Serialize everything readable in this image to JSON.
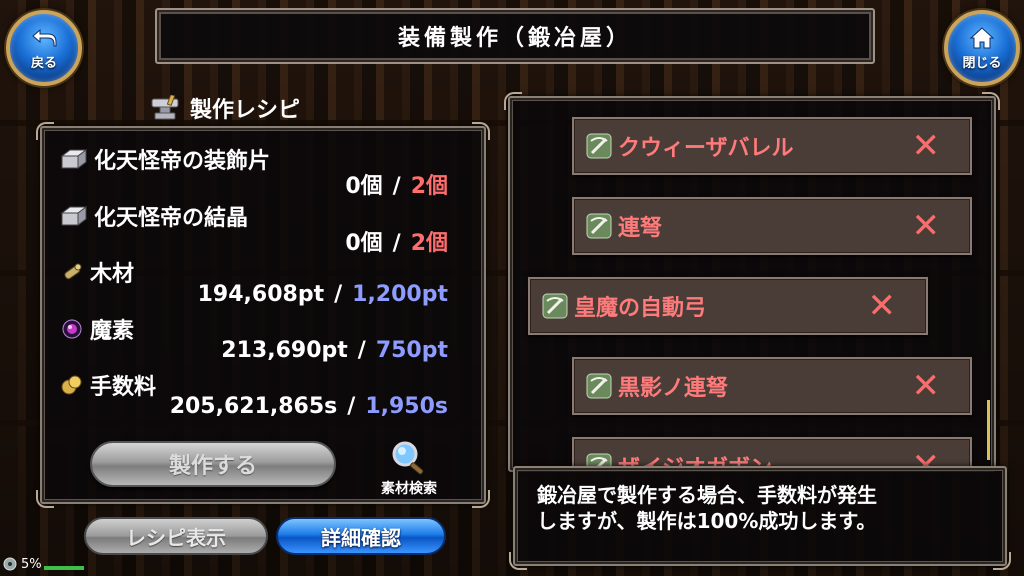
{
  "nav": {
    "back_label": "戻る",
    "close_label": "閉じる"
  },
  "title": "装備製作（鍛冶屋）",
  "recipe_panel": {
    "header": "製作レシピ",
    "materials": [
      {
        "icon": "ingot-icon",
        "name": "化天怪帝の装飾片",
        "have": "0個",
        "need": "2個",
        "need_color": "#ff6d6d"
      },
      {
        "icon": "ingot-icon",
        "name": "化天怪帝の結晶",
        "have": "0個",
        "need": "2個",
        "need_color": "#ff6d6d"
      },
      {
        "icon": "wood-icon",
        "name": "木材",
        "have": "194,608pt",
        "need": "1,200pt",
        "need_color": "#8e9cff"
      },
      {
        "icon": "magic-orb-icon",
        "name": "魔素",
        "have": "213,690pt",
        "need": "750pt",
        "need_color": "#8e9cff"
      },
      {
        "icon": "coin-icon",
        "name": "手数料",
        "have": "205,621,865s",
        "need": "1,950s",
        "need_color": "#8e9cff"
      }
    ],
    "slash": "/",
    "craft_button": "製作する",
    "search_label": "素材検索"
  },
  "bottom_buttons": {
    "recipe_view": "レシピ表示",
    "detail_confirm": "詳細確認"
  },
  "recipe_list": {
    "items": [
      {
        "name": "クウィーザバレル",
        "mark": "✕",
        "selected": false
      },
      {
        "name": "連弩",
        "mark": "✕",
        "selected": false
      },
      {
        "name": "皇魔の自動弓",
        "mark": "✕",
        "selected": true
      },
      {
        "name": "黒影ノ連弩",
        "mark": "✕",
        "selected": false
      },
      {
        "name": "ザイジオガボン",
        "mark": "✕",
        "selected": false
      }
    ]
  },
  "info": "鍛冶屋で製作する場合、手数料が発生\nしますが、製作は100%成功します。",
  "status": {
    "percent": "5%"
  },
  "colors": {
    "accent_red": "#ff6d6d",
    "accent_blue": "#8e9cff",
    "nav_blue": "#1a6fd6",
    "gold": "#c9a45a"
  }
}
